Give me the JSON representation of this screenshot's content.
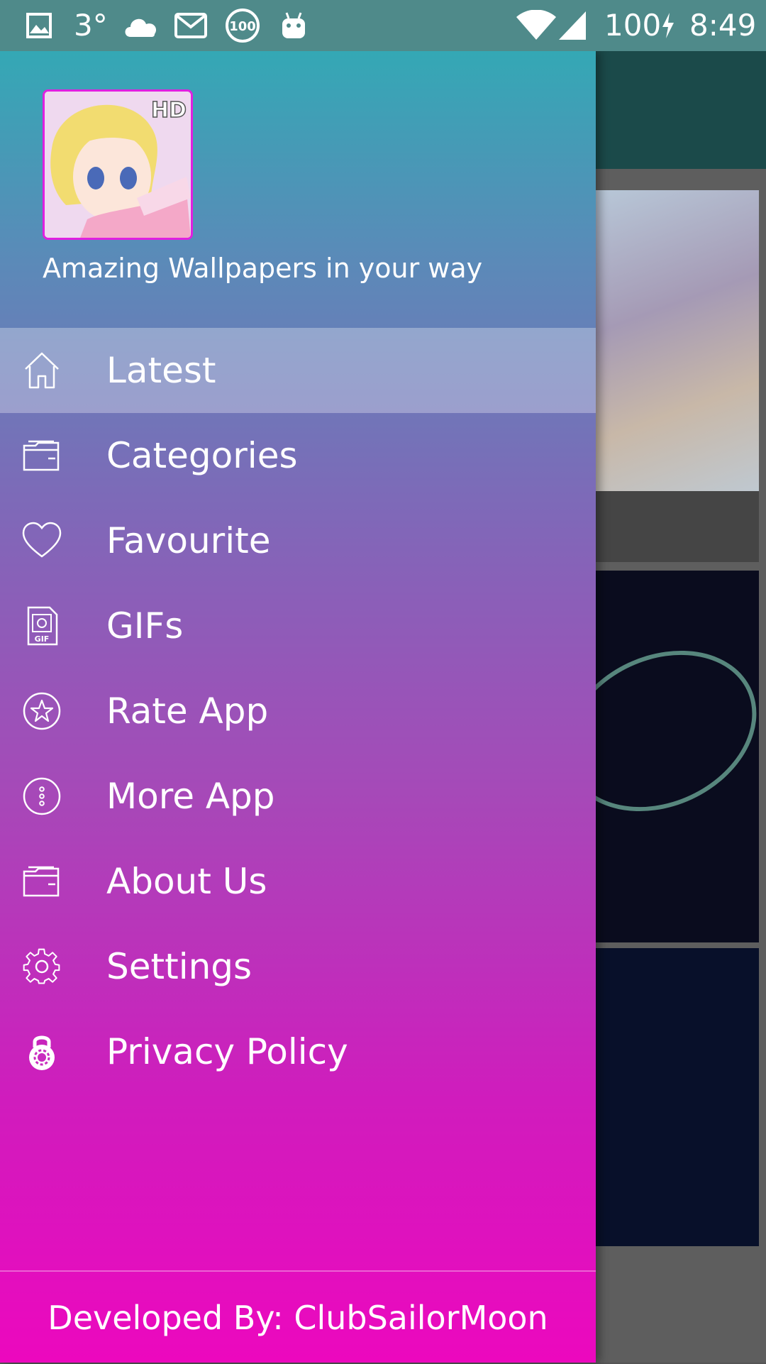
{
  "status_bar": {
    "temperature": "3°",
    "notification_badge": "100",
    "battery": "100",
    "time": "8:49",
    "icons": [
      "image-icon",
      "cloud-icon",
      "mail-icon",
      "badge-100-icon",
      "android-icon",
      "wifi-icon",
      "signal-icon",
      "charging-icon"
    ]
  },
  "drawer": {
    "header": {
      "avatar_badge": "HD",
      "tagline": "Amazing Wallpapers in your way"
    },
    "items": [
      {
        "label": "Latest",
        "icon": "home-icon",
        "selected": true
      },
      {
        "label": "Categories",
        "icon": "folder-icon",
        "selected": false
      },
      {
        "label": "Favourite",
        "icon": "heart-icon",
        "selected": false
      },
      {
        "label": "GIFs",
        "icon": "gif-file-icon",
        "selected": false
      },
      {
        "label": "Rate App",
        "icon": "star-circle-icon",
        "selected": false
      },
      {
        "label": "More App",
        "icon": "more-circle-icon",
        "selected": false
      },
      {
        "label": "About Us",
        "icon": "folder-icon",
        "selected": false
      },
      {
        "label": "Settings",
        "icon": "gear-icon",
        "selected": false
      },
      {
        "label": "Privacy Policy",
        "icon": "lock-icon",
        "selected": false
      }
    ],
    "footer": "Developed By: ClubSailorMoon"
  },
  "colors": {
    "status_bar": "#4f8a8a",
    "drawer_top": "#34a8b5",
    "drawer_bottom": "#ec08be",
    "app_bar": "#1b4a4a"
  }
}
